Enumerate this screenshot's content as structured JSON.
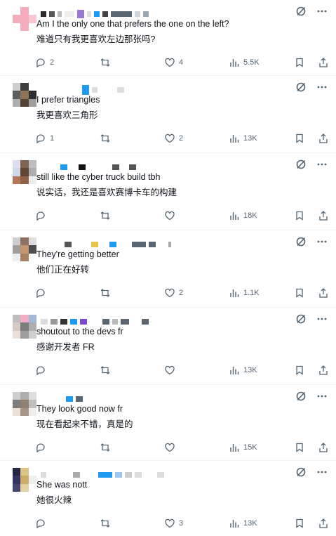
{
  "colors": {
    "text": "#0f1419",
    "muted": "#536471",
    "divider": "#eff3f4"
  },
  "tweets": [
    {
      "text_en": "Am I the only one that prefers the one on the left?",
      "text_zh": "难道只有我更喜欢左边那张吗?",
      "replies": "2",
      "retweets": "",
      "likes": "4",
      "views": "5.5K"
    },
    {
      "text_en": "I prefer triangles",
      "text_zh": "我更喜欢三角形",
      "replies": "1",
      "retweets": "",
      "likes": "2",
      "views": "13K"
    },
    {
      "text_en": "still like the cyber truck build tbh",
      "text_zh": "说实话，我还是喜欢赛博卡车的构建",
      "replies": "",
      "retweets": "",
      "likes": "",
      "views": "18K"
    },
    {
      "text_en": "They're getting better",
      "text_zh": "他们正在好转",
      "replies": "",
      "retweets": "",
      "likes": "2",
      "views": "1.1K"
    },
    {
      "text_en": "shoutout to the devs fr",
      "text_zh": "感谢开发者 FR",
      "replies": "",
      "retweets": "",
      "likes": "",
      "views": "13K"
    },
    {
      "text_en": "They look good now fr",
      "text_zh": "现在看起来不错，真是的",
      "replies": "",
      "retweets": "",
      "likes": "",
      "views": "15K"
    },
    {
      "text_en": "She was nott",
      "text_zh": "她很火辣",
      "replies": "",
      "retweets": "",
      "likes": "3",
      "views": "13K"
    }
  ],
  "icons": {
    "reply": "reply-icon",
    "retweet": "retweet-icon",
    "like": "like-icon",
    "views": "views-icon",
    "bookmark": "bookmark-icon",
    "share": "share-icon",
    "grok": "grok-icon",
    "more": "more-icon"
  }
}
